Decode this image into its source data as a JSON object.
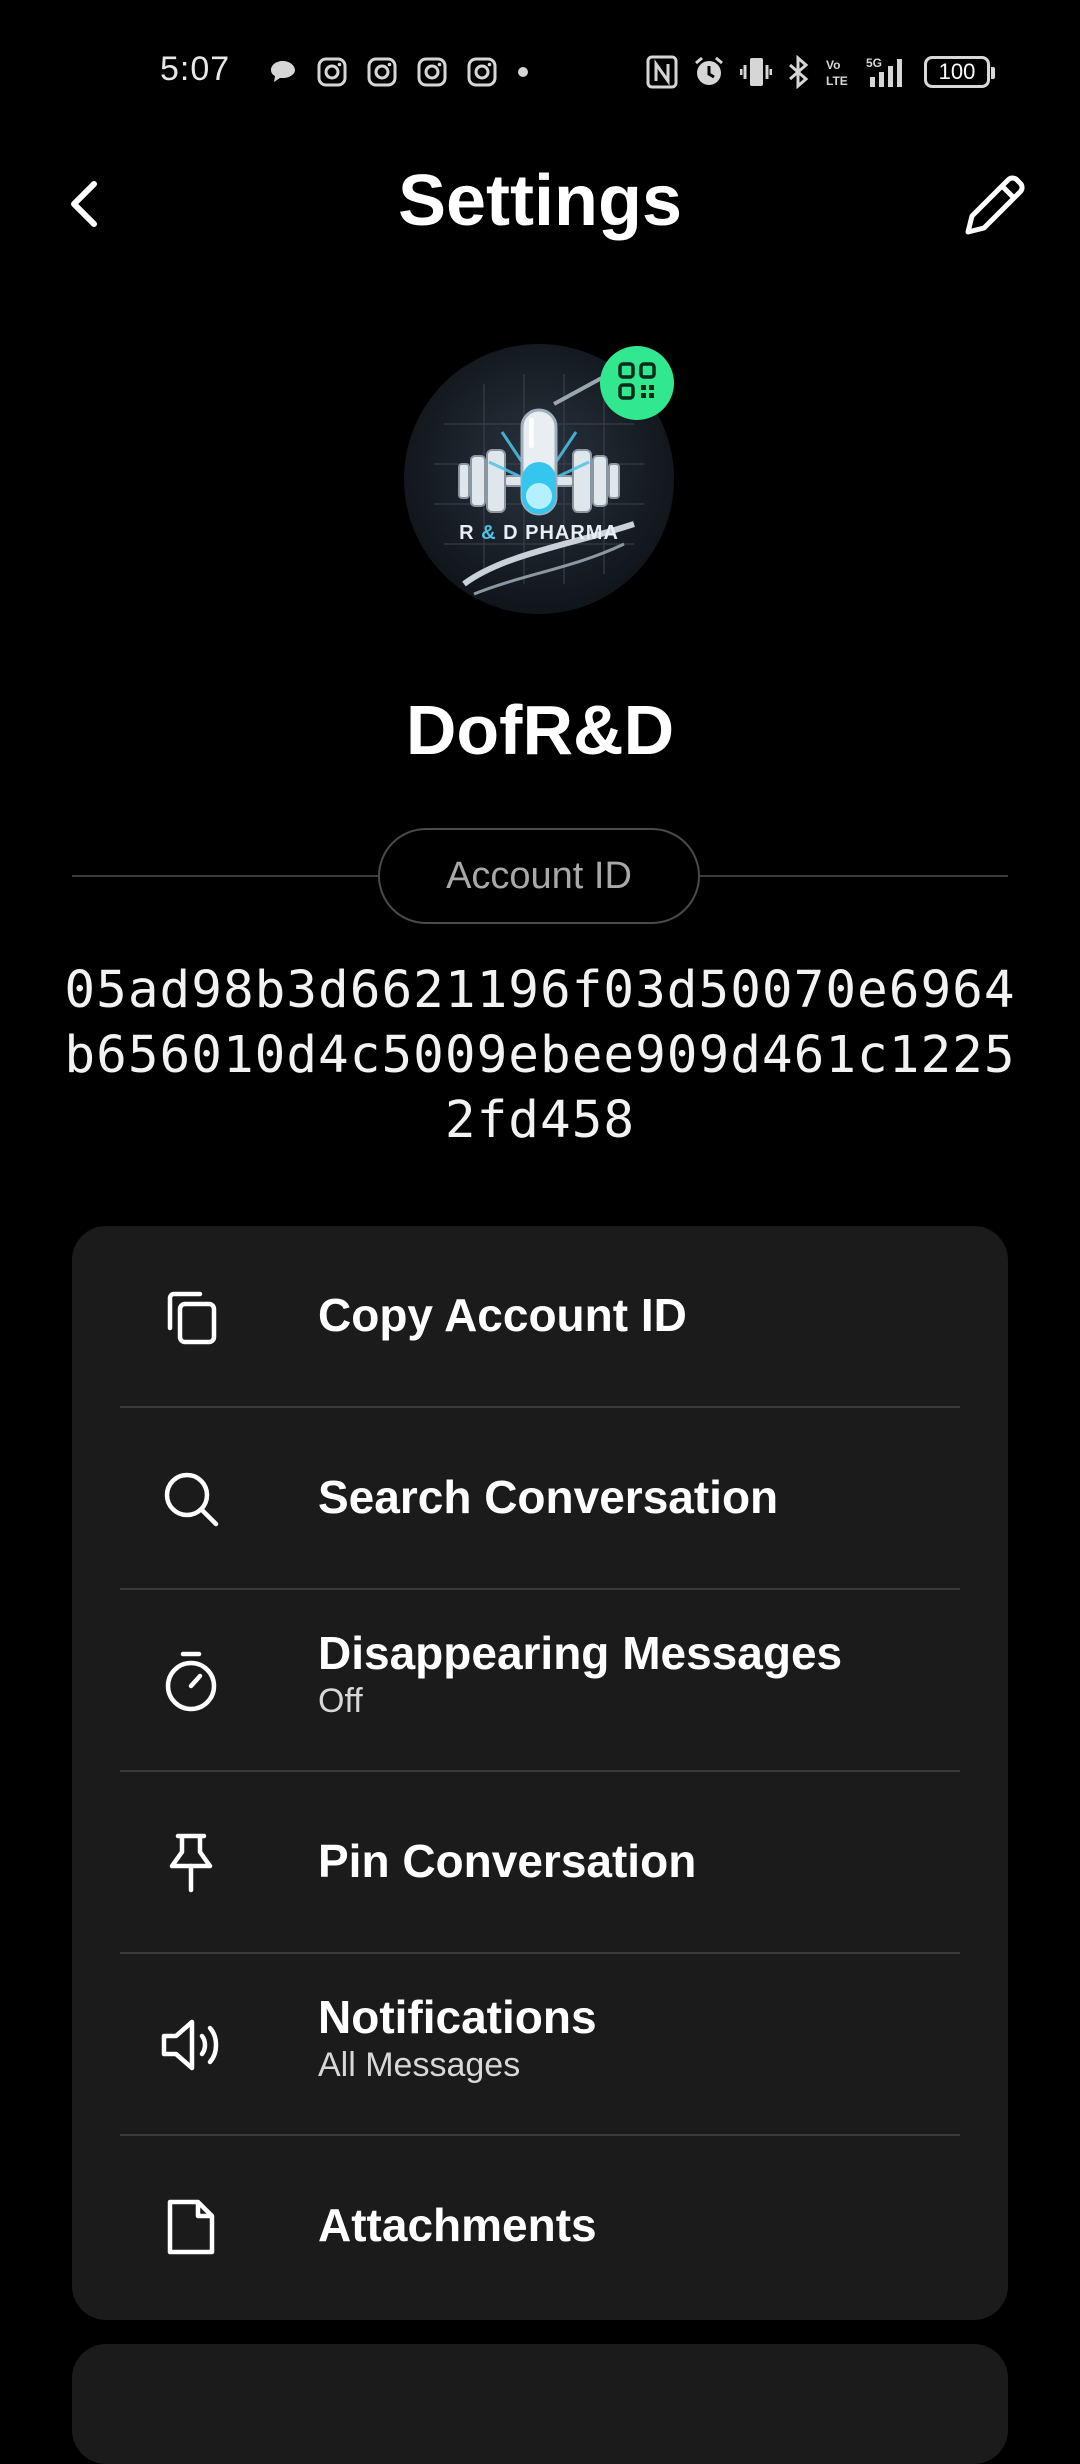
{
  "status_bar": {
    "time": "5:07",
    "battery": "100",
    "notification_icons": [
      "chat-bubble-icon",
      "instagram-icon",
      "instagram-icon",
      "instagram-icon",
      "instagram-icon",
      "dot-icon"
    ],
    "system_icons": [
      "nfc-icon",
      "alarm-icon",
      "vibrate-icon",
      "bluetooth-icon",
      "volte-icon",
      "5g-signal-icon",
      "battery-icon"
    ]
  },
  "header": {
    "title": "Settings",
    "back_icon": "chevron-left-icon",
    "edit_icon": "pencil-icon"
  },
  "profile": {
    "avatar_text_r": "R",
    "avatar_text_amp": "&",
    "avatar_text_d": "D PHARMA",
    "qr_icon": "qr-code-icon",
    "display_name": "DofR&D",
    "account_id_label": "Account ID",
    "account_id": "05ad98b3d6621196f03d50070e6964b656010d4c5009ebee909d461c12252fd458"
  },
  "menu": [
    {
      "label": "Copy Account ID",
      "sub": "",
      "icon": "copy-icon"
    },
    {
      "label": "Search Conversation",
      "sub": "",
      "icon": "search-icon"
    },
    {
      "label": "Disappearing Messages",
      "sub": "Off",
      "icon": "timer-icon"
    },
    {
      "label": "Pin Conversation",
      "sub": "",
      "icon": "pin-icon"
    },
    {
      "label": "Notifications",
      "sub": "All Messages",
      "icon": "speaker-icon"
    },
    {
      "label": "Attachments",
      "sub": "",
      "icon": "file-icon"
    }
  ],
  "colors": {
    "background": "#000000",
    "card": "#1b1b1b",
    "accent": "#31e88f"
  }
}
